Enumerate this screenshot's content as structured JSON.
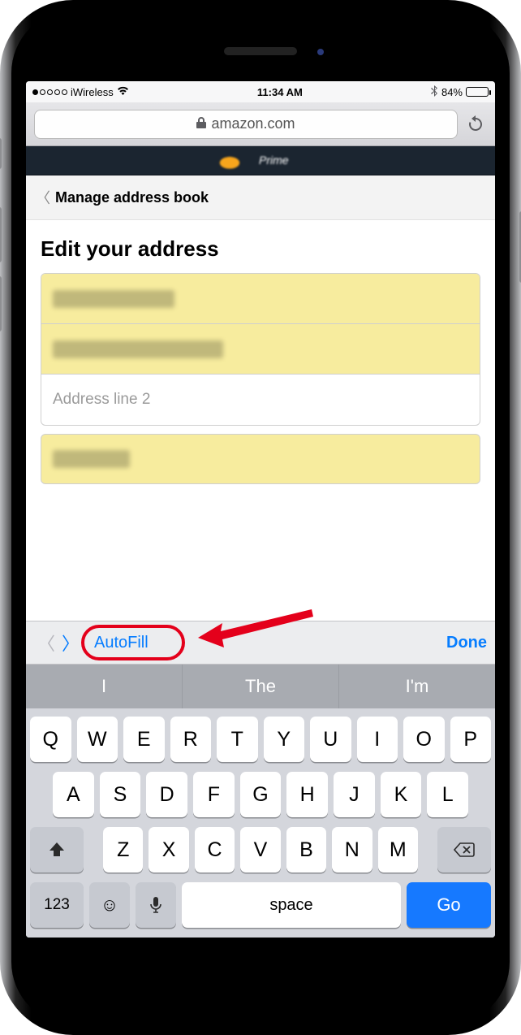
{
  "status": {
    "carrier": "iWireless",
    "time": "11:34 AM",
    "battery_pct": "84%",
    "battery_fill_pct": 84
  },
  "safari": {
    "domain": "amazon.com"
  },
  "page": {
    "prime_label": "Prime",
    "breadcrumb": "Manage address book",
    "title": "Edit your address",
    "address_line2_placeholder": "Address line 2"
  },
  "kbd_accessory": {
    "autofill": "AutoFill",
    "done": "Done"
  },
  "predictions": [
    "I",
    "The",
    "I'm"
  ],
  "keyboard": {
    "row1": [
      "Q",
      "W",
      "E",
      "R",
      "T",
      "Y",
      "U",
      "I",
      "O",
      "P"
    ],
    "row2": [
      "A",
      "S",
      "D",
      "F",
      "G",
      "H",
      "J",
      "K",
      "L"
    ],
    "row3": [
      "Z",
      "X",
      "C",
      "V",
      "B",
      "N",
      "M"
    ],
    "key_123": "123",
    "key_space": "space",
    "key_go": "Go"
  }
}
